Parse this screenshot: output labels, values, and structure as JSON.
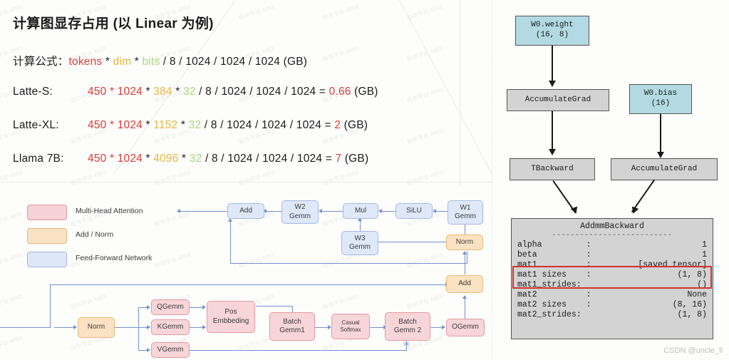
{
  "title": "计算图显存占用 (以 Linear 为例)",
  "formula": {
    "label": "计算公式：",
    "tokens": "tokens",
    "op1": " * ",
    "dim": "dim",
    "op2": " * ",
    "bits": "bits",
    "tail": " / 8 / 1024 / 1024 / 1024 (GB)"
  },
  "rows": [
    {
      "name": "Latte-S:",
      "tokens": "450 * 1024",
      "star1": " * ",
      "dim": "384",
      "star2": " * ",
      "bits": "32",
      "divisors": " / 8 / 1024 / 1024 / 1024 = ",
      "result": "0.66",
      "unit": " (GB)"
    },
    {
      "name": "Latte-XL:",
      "tokens": "450 * 1024",
      "star1": " * ",
      "dim": "1152",
      "star2": " * ",
      "bits": "32",
      "divisors": " / 8 / 1024 / 1024 / 1024 = ",
      "result": "2",
      "unit": " (GB)"
    },
    {
      "name": "Llama 7B:",
      "tokens": "450 * 1024",
      "star1": " * ",
      "dim": "4096",
      "star2": " * ",
      "bits": "32",
      "divisors": " / 8 / 1024 / 1024 / 1024 = ",
      "result": "7",
      "unit": " (GB)"
    }
  ],
  "colors": {
    "red": "#e03a35",
    "orange": "#e8b63c",
    "green": "#a8d77c",
    "attention_fill": "#f8d5d8",
    "attention_stroke": "#e19aa2",
    "norm_fill": "#fbe2c2",
    "norm_stroke": "#e9b877",
    "ffn_fill": "#dfe8f9",
    "ffn_stroke": "#a3bae4",
    "edge": "#7390cf",
    "graph_blue": "#b3dae2",
    "graph_gray": "#d3d3d3",
    "highlight": "#d63030"
  },
  "legend": [
    {
      "label": "Multi-Head Attention",
      "swatch": "attention"
    },
    {
      "label": "Add / Norm",
      "swatch": "norm"
    },
    {
      "label": "Feed-Forward Network",
      "swatch": "ffn"
    }
  ],
  "diagram": {
    "nodes": {
      "add_left": "Add",
      "w2_gemm": "W2\nGemm",
      "mul": "Mul",
      "silu": "SiLU",
      "w1_gemm": "W1\nGemm",
      "w3_gemm": "W3\nGemm",
      "norm_right": "Norm",
      "add_right": "Add",
      "norm_left": "Norm",
      "q_gemm": "QGemm",
      "k_gemm": "KGemm",
      "v_gemm": "VGemm",
      "pos_embedding": "Pos\nEmbbeding",
      "batch_gemm1": "Batch\nGemm1",
      "casual_softmax": "Casual\nSoftmax",
      "batch_gemm2": "Batch\nGemm 2",
      "o_gemm": "OGemm"
    },
    "star": "✳"
  },
  "graph": {
    "w0_weight": "W0.weight\n(16, 8)",
    "accumulate_grad_1": "AccumulateGrad",
    "w0_bias": "W0.bias\n(16)",
    "t_backward": "TBackward",
    "accumulate_grad_2": "AccumulateGrad",
    "addmm": {
      "title": "AddmmBackward",
      "separator": "--------------------------",
      "rows": [
        {
          "key": "alpha         :",
          "value": "1"
        },
        {
          "key": "beta          :",
          "value": "1"
        },
        {
          "key": "mat1          :",
          "value": "[saved tensor]"
        },
        {
          "key": "mat1 sizes    :",
          "value": "(1, 8)"
        },
        {
          "key": "mat1_strides:",
          "value": "()"
        },
        {
          "key": "mat2          :",
          "value": "None"
        },
        {
          "key": "mat2 sizes    :",
          "value": "(8, 16)"
        },
        {
          "key": "mat2_strides:",
          "value": "(1, 8)"
        }
      ]
    }
  },
  "watermark": {
    "csdn": "CSDN @uncle_ll",
    "tile": "极市平台 4893"
  }
}
